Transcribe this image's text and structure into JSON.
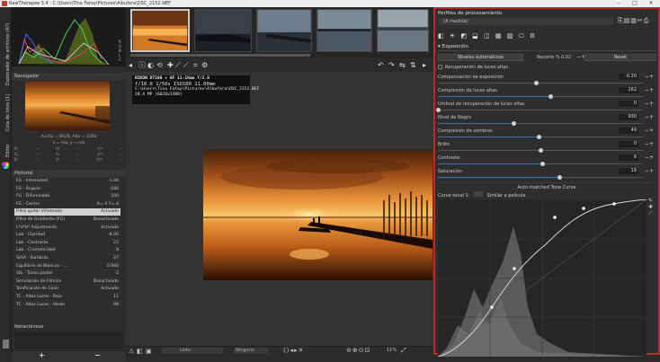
{
  "window": {
    "title": "RawTherapee 5.4 - C:\\Users\\Tina Fatay\\Pictures\\Albufera\\DSC_2152.NEF"
  },
  "left_tabs": [
    "Explorador de archivos (47)",
    "Cola de lotes [1]",
    "Editor"
  ],
  "navigator": {
    "title": "Navegador",
    "size_text": "Ancho = 6028, Alto = 3380",
    "coords_text": "x = n/a, y = n/a",
    "rgb_rows": [
      [
        "R:",
        "--",
        "H:",
        "--",
        "L*:",
        "--"
      ],
      [
        "G:",
        "--",
        "S:",
        "--",
        "a*:",
        "--"
      ],
      [
        "B:",
        "--",
        "V:",
        "--",
        "b*:",
        "--"
      ]
    ]
  },
  "history": {
    "title": "Historial",
    "items": [
      {
        "name": "FG - Intensidad",
        "value": "-1.04"
      },
      {
        "name": "FG - Ángulo",
        "value": "-180"
      },
      {
        "name": "FG - Difuminado",
        "value": "100"
      },
      {
        "name": "FG - Centro",
        "value": "X=-4  Y=-4"
      },
      {
        "name": "Filtro quitar Viñeteado",
        "value": "Activado",
        "selected": true
      },
      {
        "name": "Filtro de Gradiente (FG)",
        "value": "Desactivado"
      },
      {
        "name": "L*a*b* Adjustments",
        "value": "Activado"
      },
      {
        "name": "Lab - Claridad",
        "value": "-8.00"
      },
      {
        "name": "Lab - Contraste",
        "value": "22"
      },
      {
        "name": "Lab - Cromaticidad",
        "value": "8"
      },
      {
        "name": "S/AA - Sombras",
        "value": "27"
      },
      {
        "name": "Equilibrio de Blancos - ...",
        "value": "0.940"
      },
      {
        "name": "Vib - Tonos pastel",
        "value": "-2"
      },
      {
        "name": "Simulación de Fílmico",
        "value": "Desactivado"
      },
      {
        "name": "Tonificación de Color",
        "value": "Activado"
      },
      {
        "name": "TC - Altas Luces - Rojo",
        "value": "11"
      },
      {
        "name": "TC - Altas Luces - Verde",
        "value": "08"
      }
    ]
  },
  "snapshots": {
    "title": "Instantáneas",
    "add": "+",
    "remove": "−",
    "percent": "0%"
  },
  "exif_overlay": {
    "line1": "NIKON D7100 + AF 11-16mm f/2.8",
    "line2": "f/10.0  1/50s  ISO100  11.00mm",
    "line3": "C:\\Users\\Tina Fatay\\Pictures\\Albufera\\DSC_2152.NEF",
    "line4": "20.4 MP (6028x3380)"
  },
  "bottom_bar": {
    "left_select": "Listo",
    "mid_select": "Ninguno",
    "zoom": "11%"
  },
  "processing": {
    "title": "Perfiles de procesamiento",
    "profile": "(A medida)",
    "section": "Exposición",
    "auto_levels": "Niveles automáticos",
    "clip_label": "Recorte %",
    "clip_value": "0.02",
    "reset": "Reset",
    "highlight_recovery": "Recuperación de luces altas",
    "params": [
      {
        "label": "Compensación de exposición",
        "value": "-0.20",
        "frac": 0.48,
        "filled": false
      },
      {
        "label": "Compresión de luces altas",
        "value": "262",
        "frac": 0.55,
        "filled": true
      },
      {
        "label": "Umbral de recuperación de luces altas",
        "value": "0",
        "frac": 0.0,
        "filled": false
      },
      {
        "label": "Nivel de Negro",
        "value": "930",
        "frac": 0.37,
        "filled": true
      },
      {
        "label": "Compresión de sombras",
        "value": "49",
        "frac": 0.49,
        "filled": true
      },
      {
        "label": "Brillo",
        "value": "0",
        "frac": 0.5,
        "filled": false
      },
      {
        "label": "Contraste",
        "value": "6",
        "frac": 0.51,
        "filled": true
      },
      {
        "label": "Saturación",
        "value": "19",
        "frac": 0.59,
        "filled": true
      }
    ],
    "tone_curve_header": "Auto-matched Tone Curve",
    "curve_label": "Curva tonal 1:",
    "curve_mode": "Similar a película"
  }
}
